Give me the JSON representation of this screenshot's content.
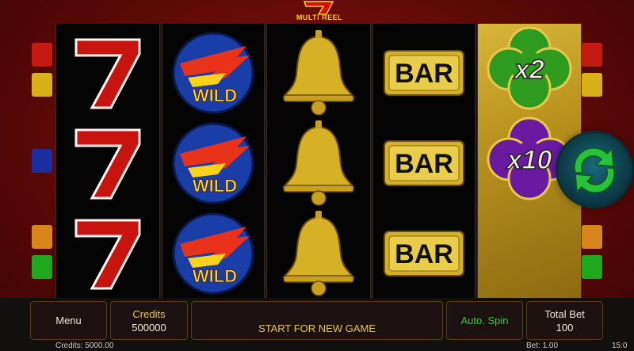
{
  "logo": {
    "text": "MULTI REEL"
  },
  "reels": [
    {
      "name": "reel-1",
      "symbols": [
        "seven",
        "seven",
        "seven"
      ]
    },
    {
      "name": "reel-2",
      "symbols": [
        "wild",
        "wild",
        "wild"
      ]
    },
    {
      "name": "reel-3",
      "symbols": [
        "bell",
        "bell",
        "bell"
      ]
    },
    {
      "name": "reel-4",
      "symbols": [
        "bar",
        "bar",
        "bar"
      ]
    }
  ],
  "symbol_text": {
    "seven": "7",
    "wild": "WILD",
    "bar": "BAR"
  },
  "multipliers": [
    {
      "label": "x2",
      "color": "#2e9a1e"
    },
    {
      "label": "x10",
      "color": "#6a1aa0"
    }
  ],
  "controls": {
    "menu_label": "Menu",
    "credits_label": "Credits",
    "credits_value": "500000",
    "start_message": "START FOR NEW GAME",
    "autospin_label": "Auto. Spin",
    "total_bet_label": "Total Bet",
    "total_bet_value": "100"
  },
  "status": {
    "credits": "Credits: 5000.00",
    "bet": "Bet: 1.00",
    "time": "15:0"
  },
  "colors": {
    "accent_gold": "#e8c25a",
    "autospin_green": "#3ec43e",
    "spin_arrow_green": "#25c23a"
  },
  "icons": {
    "spin": "refresh-arrows-icon"
  }
}
